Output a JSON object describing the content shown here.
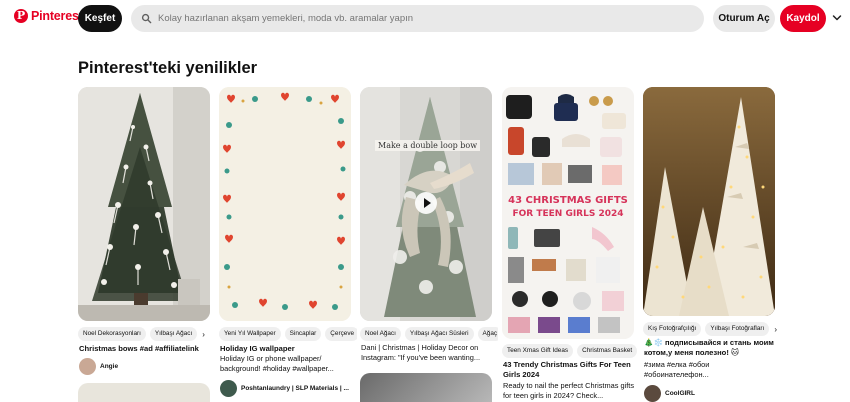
{
  "header": {
    "logo_mark": "P",
    "logo_text": "Pinterest",
    "explore_label": "Keşfet",
    "search_placeholder": "Kolay hazırlanan akşam yemekleri, moda vb. aramalar yapın",
    "login_label": "Oturum Aç",
    "signup_label": "Kaydol"
  },
  "section_title": "Pinterest'teki yenilikler",
  "colors": {
    "brand": "#e60023",
    "dark": "#111111",
    "chip": "#efefef"
  },
  "cards": [
    {
      "tags": [
        "Noel Dekorasyonları",
        "Yılbaşı Ağacı"
      ],
      "title": "Christmas bows #ad #affiliatelink",
      "description": "",
      "author": "Angie"
    },
    {
      "tags": [
        "Yeni Yıl Wallpaper",
        "Sincaplar",
        "Çerçeve"
      ],
      "title": "Holiday IG wallpaper",
      "description": "Holiday IG or phone wallpaper/ background! #holiday #wallpaper...",
      "author": "Poshtanlaundry | SLP Materials | ..."
    },
    {
      "tags": [
        "Noel Ağacı",
        "Yılbaşı Ağacı Süsleri",
        "Ağaç"
      ],
      "overlay_text": "Make a double loop bow",
      "title": "",
      "description": "Dani | Christmas | Holiday Decor on Instagram: \"If you've been wanting...",
      "author": ""
    },
    {
      "tags": [
        "Teen Xmas Gift Ideas",
        "Christmas Basket"
      ],
      "overlay_line1": "43 CHRISTMAS GIFTS",
      "overlay_line2": "FOR TEEN GIRLS 2024",
      "title": "43 Trendy Christmas Gifts For Teen Girls 2024",
      "description": "Ready to nail the perfect Christmas gifts for teen girls in 2024? Check...",
      "author": ""
    },
    {
      "tags": [
        "Kış Fotoğrafçılığı",
        "Yılbaşı Fotoğrafları"
      ],
      "title": "🎄❄️ подписывайся и стань моим котом,у меня полезно! 🐱",
      "description": "#зима #елка #обои #обоинателефон...",
      "author": "CoolGIRL"
    }
  ]
}
